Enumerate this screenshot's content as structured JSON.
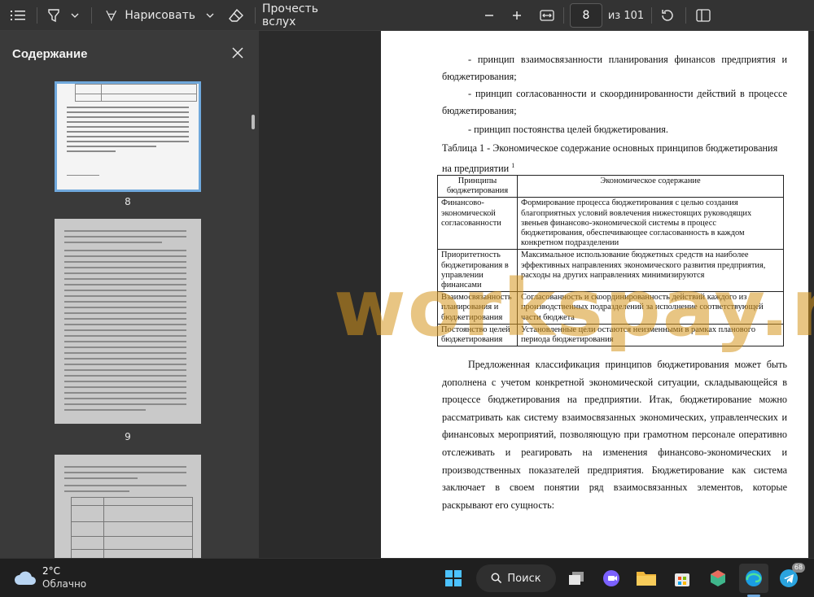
{
  "toolbar": {
    "draw_label": "Нарисовать",
    "read_aloud_label": "Прочесть вслух",
    "page_number": "8",
    "page_total": "из 101"
  },
  "sidebar": {
    "title": "Содержание",
    "thumbnails": [
      {
        "number": "8",
        "selected": true
      },
      {
        "number": "9",
        "selected": false
      }
    ]
  },
  "document": {
    "lines": [
      "- принцип взаимосвязанности планирования финансов предприятия и бюджетирования;",
      "- принцип согласованности и скоординированности действий в процессе бюджетирования;",
      "- принцип постоянства целей бюджетирования."
    ],
    "table_caption": "Таблица 1 - Экономическое содержание основных принципов бюджетирования на предприятии",
    "table_footnote_mark": "1",
    "table_headers": [
      "Принципы бюджетирования",
      "Экономическое содержание"
    ],
    "table_rows": [
      {
        "principle": "Финансово-экономической согласованности",
        "content": "Формирование процесса бюджетирования с целью создания благоприятных условий вовлечения нижестоящих руководящих звеньев финансово-экономической системы в процесс бюджетирования, обеспечивающее согласованность в каждом конкретном подразделении"
      },
      {
        "principle": "Приоритетность бюджетирования в управлении финансами",
        "content": "Максимальное использование бюджетных средств на наиболее эффективных направлениях экономического развития предприятия, расходы на других направлениях минимизируются"
      },
      {
        "principle": "Взаимосвязанность планирования и бюджетирования",
        "content": "Согласованность и скоординированность действий каждого из производственных подразделений за исполнение соответствующей части бюджета"
      },
      {
        "principle": "Постоянство целей бюджетирования",
        "content": "Установленные цели остаются неизменными в рамках планового периода бюджетирования"
      }
    ],
    "paragraph": "Предложенная классификация принципов бюджетирования может быть дополнена с учетом конкретной экономической ситуации, складывающейся в процессе бюджетирования на предприятии. Итак, бюджетирование можно рассматривать как систему взаимосвязанных экономических, управленческих и финансовых мероприятий, позволяющую при грамотном персонале оперативно отслеживать и реагировать на изменения финансово-экономических и производственных показателей предприятия. Бюджетирование как система заключает в своем понятии ряд взаимосвязанных элементов, которые раскрывают его сущность:",
    "watermark": "workspay.ru"
  },
  "taskbar": {
    "weather_temp": "2°C",
    "weather_desc": "Облачно",
    "search_label": "Поиск",
    "telegram_badge": "68"
  },
  "colors": {
    "accent": "#6fa8dc",
    "watermark": "#d6961e",
    "toolbar_bg": "#333333",
    "sidebar_bg": "#3a3a3a"
  }
}
